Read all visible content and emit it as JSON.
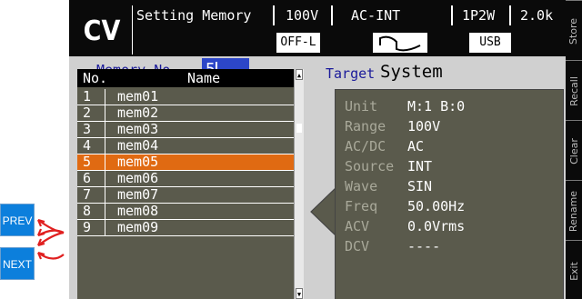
{
  "header": {
    "mode": "CV",
    "title": "Setting Memory",
    "range": "100V",
    "source": "AC-INT",
    "phase": "1P2W",
    "capacity": "2.0k",
    "output_state": "OFF-L",
    "usb": "USB",
    "waveform_icon": "sine-wave-icon"
  },
  "memory": {
    "label": "Memory No.",
    "value": "5"
  },
  "list": {
    "headers": [
      "No.",
      "Name"
    ],
    "rows": [
      {
        "no": "1",
        "name": "mem01"
      },
      {
        "no": "2",
        "name": "mem02"
      },
      {
        "no": "3",
        "name": "mem03"
      },
      {
        "no": "4",
        "name": "mem04"
      },
      {
        "no": "5",
        "name": "mem05"
      },
      {
        "no": "6",
        "name": "mem06"
      },
      {
        "no": "7",
        "name": "mem07"
      },
      {
        "no": "8",
        "name": "mem08"
      },
      {
        "no": "9",
        "name": "mem09"
      }
    ],
    "selected_index": 4
  },
  "target": {
    "label": "Target",
    "value": "System",
    "details": [
      {
        "label": "Unit",
        "value": "M:1 B:0"
      },
      {
        "label": "Range",
        "value": "100V"
      },
      {
        "label": "AC/DC",
        "value": "AC"
      },
      {
        "label": "Source",
        "value": "INT"
      },
      {
        "label": "Wave",
        "value": "SIN"
      },
      {
        "label": "Freq",
        "value": "50.00Hz"
      },
      {
        "label": "ACV",
        "value": "0.0Vrms"
      },
      {
        "label": "DCV",
        "value": "----"
      }
    ]
  },
  "softkeys": [
    "Store",
    "Recall",
    "Clear",
    "Rename",
    "Exit"
  ],
  "buttons": {
    "prev": "PREV",
    "next": "NEXT"
  },
  "colors": {
    "header_bg": "#0a0a0a",
    "selected_row": "#e06a12",
    "list_bg": "#5a5a4c",
    "memory_field": "#2c46c8",
    "nav_button": "#0c7fdc",
    "arrow": "#e02020"
  }
}
